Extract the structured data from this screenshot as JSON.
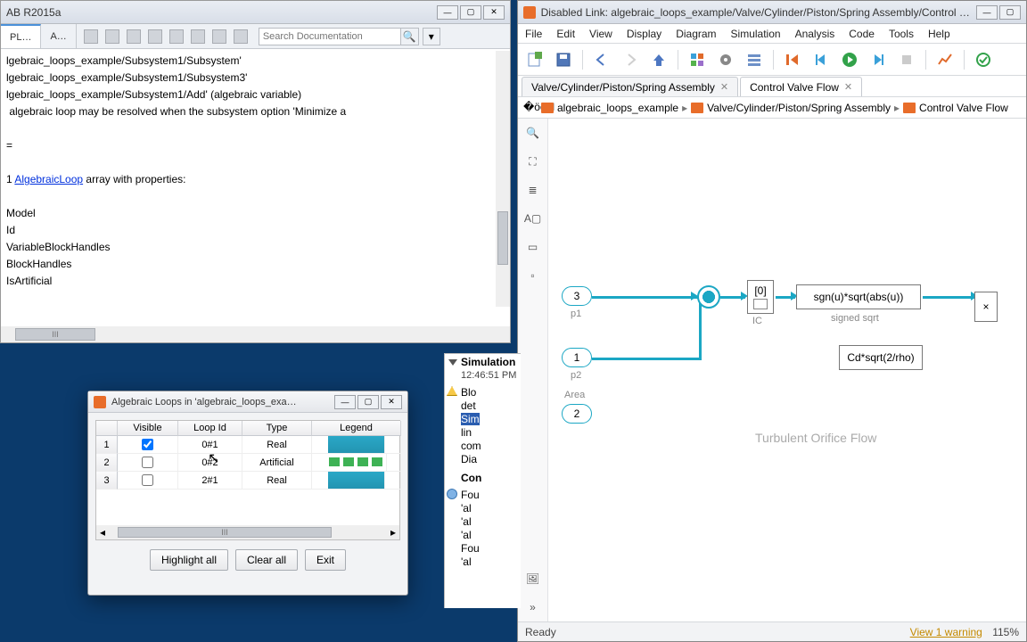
{
  "matlab": {
    "title": "AB R2015a",
    "tabs": {
      "pl": "PL…",
      "a": "A…"
    },
    "search_placeholder": "Search Documentation",
    "content_pre": "lgebraic_loops_example/Subsystem1/Subsystem'\nlgebraic_loops_example/Subsystem1/Subsystem3'\nlgebraic_loops_example/Subsystem1/Add' (algebraic variable)\n algebraic loop may be resolved when the subsystem option 'Minimize a\n\n=\n\n1 ",
    "content_link": "AlgebraicLoop",
    "content_post": " array with properties:\n\nModel\nId\nVariableBlockHandles\nBlockHandles\nIsArtificial\n"
  },
  "al_dialog": {
    "title": "Algebraic Loops in 'algebraic_loops_exa…",
    "headers": [
      "",
      "Visible",
      "Loop Id",
      "Type",
      "Legend"
    ],
    "rows": [
      {
        "n": "1",
        "visible": true,
        "loop": "0#1",
        "type": "Real",
        "legend": "solid"
      },
      {
        "n": "2",
        "visible": false,
        "loop": "0#2",
        "type": "Artificial",
        "legend": "dash"
      },
      {
        "n": "3",
        "visible": false,
        "loop": "2#1",
        "type": "Real",
        "legend": "solid"
      }
    ],
    "buttons": {
      "highlight": "Highlight all",
      "clear": "Clear all",
      "exit": "Exit"
    },
    "ellipsis": "III"
  },
  "sim": {
    "title": "Simulation",
    "time": "12:46:51 PM",
    "lines": {
      "l1": "Blo",
      "l2": "det",
      "sel": "Sim",
      "l3": "lin",
      "l4": "com",
      "l5": "Dia"
    },
    "comp": "Con",
    "info": {
      "l1": "Fou",
      "l2": "'al",
      "l3": "'al",
      "l4": "'al",
      "l5": "Fou",
      "l6": "'al"
    }
  },
  "slk": {
    "title": "Disabled Link: algebraic_loops_example/Valve/Cylinder/Piston/Spring Assembly/Control Val…",
    "menu": [
      "File",
      "Edit",
      "View",
      "Display",
      "Diagram",
      "Simulation",
      "Analysis",
      "Code",
      "Tools",
      "Help"
    ],
    "tabs": [
      {
        "label": "Valve/Cylinder/Piston/Spring Assembly",
        "active": false
      },
      {
        "label": "Control Valve Flow",
        "active": true
      }
    ],
    "breadcrumb": [
      "algebraic_loops_example",
      "Valve/Cylinder/Piston/Spring Assembly",
      "Control Valve Flow"
    ],
    "ports": {
      "p1": {
        "n": "3",
        "label": "p1"
      },
      "p2": {
        "n": "1",
        "label": "p2"
      },
      "area": {
        "n": "2",
        "label": "Area"
      }
    },
    "blocks": {
      "ic": {
        "top": "[0]",
        "label": "IC"
      },
      "fn": {
        "expr": "sgn(u)*sqrt(abs(u))",
        "label": "signed sqrt"
      },
      "gain": {
        "expr": "Cd*sqrt(2/rho)"
      },
      "mul": "×"
    },
    "caption": "Turbulent Orifice Flow",
    "status": {
      "ready": "Ready",
      "warning": "View 1 warning",
      "zoom": "115%"
    }
  }
}
